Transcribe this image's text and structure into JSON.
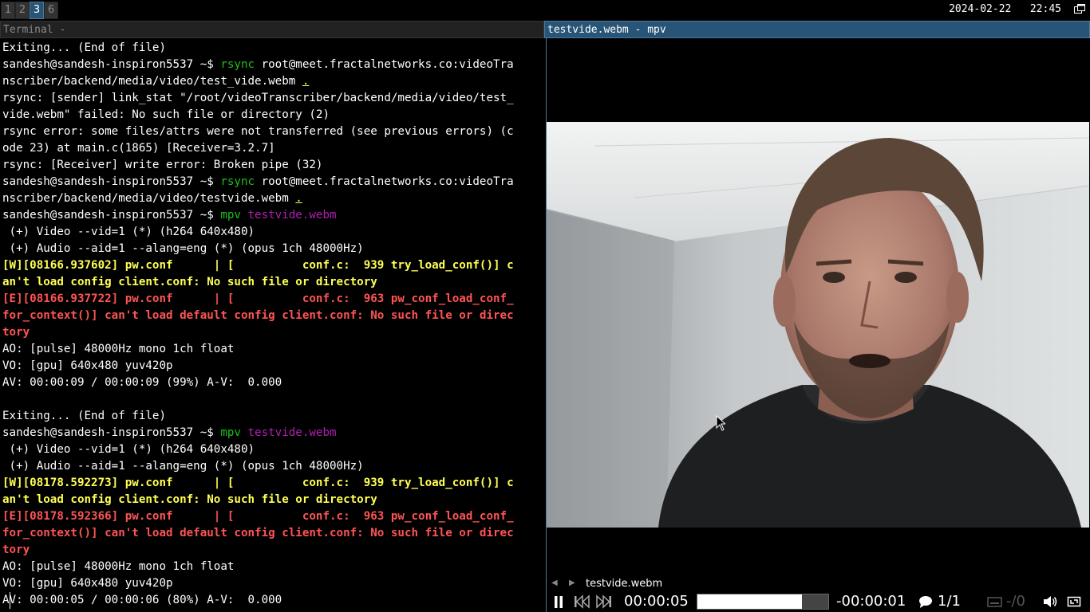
{
  "topbar": {
    "workspaces": [
      {
        "label": "1",
        "active": false
      },
      {
        "label": "2",
        "active": false
      },
      {
        "label": "3",
        "active": true
      },
      {
        "label": "6",
        "active": false
      }
    ],
    "date": "2024-02-22",
    "time": "22:45"
  },
  "terminal": {
    "title": "Terminal -",
    "lines": [
      {
        "type": "plain",
        "text": "Exiting... (End of file)"
      },
      {
        "type": "cmd",
        "prompt": "sandesh@sandesh-inspiron5537 ~$ ",
        "cmd": "rsync",
        "rest": " root@meet.fractalnetworks.co:videoTra"
      },
      {
        "type": "cont",
        "text": "nscriber/backend/media/video/test_vide.webm ",
        "und": "."
      },
      {
        "type": "plain",
        "text": "rsync: [sender] link_stat \"/root/videoTranscriber/backend/media/video/test_"
      },
      {
        "type": "plain",
        "text": "vide.webm\" failed: No such file or directory (2)"
      },
      {
        "type": "plain",
        "text": "rsync error: some files/attrs were not transferred (see previous errors) (c"
      },
      {
        "type": "plain",
        "text": "ode 23) at main.c(1865) [Receiver=3.2.7]"
      },
      {
        "type": "plain",
        "text": "rsync: [Receiver] write error: Broken pipe (32)"
      },
      {
        "type": "cmd",
        "prompt": "sandesh@sandesh-inspiron5537 ~$ ",
        "cmd": "rsync",
        "rest": " root@meet.fractalnetworks.co:videoTra"
      },
      {
        "type": "cont",
        "text": "nscriber/backend/media/video/testvide.webm ",
        "und": "."
      },
      {
        "type": "mpv",
        "prompt": "sandesh@sandesh-inspiron5537 ~$ ",
        "cmd": "mpv",
        "arg": " testvide.webm"
      },
      {
        "type": "plain",
        "text": " (+) Video --vid=1 (*) (h264 640x480)"
      },
      {
        "type": "plain",
        "text": " (+) Audio --aid=1 --alang=eng (*) (opus 1ch 48000Hz)"
      },
      {
        "type": "warn",
        "text": "[W][08166.937602] pw.conf      | [          conf.c:  939 try_load_conf()] c"
      },
      {
        "type": "warn",
        "text": "an't load config client.conf: No such file or directory"
      },
      {
        "type": "err",
        "text": "[E][08166.937722] pw.conf      | [          conf.c:  963 pw_conf_load_conf_"
      },
      {
        "type": "err",
        "text": "for_context()] can't load default config client.conf: No such file or direc"
      },
      {
        "type": "err",
        "text": "tory"
      },
      {
        "type": "plain",
        "text": "AO: [pulse] 48000Hz mono 1ch float"
      },
      {
        "type": "plain",
        "text": "VO: [gpu] 640x480 yuv420p"
      },
      {
        "type": "plain",
        "text": "AV: 00:00:09 / 00:00:09 (99%) A-V:  0.000"
      },
      {
        "type": "plain",
        "text": ""
      },
      {
        "type": "plain",
        "text": "Exiting... (End of file)"
      },
      {
        "type": "mpv",
        "prompt": "sandesh@sandesh-inspiron5537 ~$ ",
        "cmd": "mpv",
        "arg": " testvide.webm"
      },
      {
        "type": "plain",
        "text": " (+) Video --vid=1 (*) (h264 640x480)"
      },
      {
        "type": "plain",
        "text": " (+) Audio --aid=1 --alang=eng (*) (opus 1ch 48000Hz)"
      },
      {
        "type": "warn",
        "text": "[W][08178.592273] pw.conf      | [          conf.c:  939 try_load_conf()] c"
      },
      {
        "type": "warn",
        "text": "an't load config client.conf: No such file or directory"
      },
      {
        "type": "err",
        "text": "[E][08178.592366] pw.conf      | [          conf.c:  963 pw_conf_load_conf_"
      },
      {
        "type": "err",
        "text": "for_context()] can't load default config client.conf: No such file or direc"
      },
      {
        "type": "err",
        "text": "tory"
      },
      {
        "type": "plain",
        "text": "AO: [pulse] 48000Hz mono 1ch float"
      },
      {
        "type": "plain",
        "text": "VO: [gpu] 640x480 yuv420p"
      },
      {
        "type": "cursorline",
        "cursor": "A",
        "text": "V: 00:00:05 / 00:00:06 (80%) A-V:  0.000"
      }
    ]
  },
  "mpv": {
    "title": "testvide.webm - mpv",
    "playlist_name": "testvide.webm",
    "time_current": "00:00:05",
    "time_remaining": "-00:00:01",
    "seek_progress": 0.8,
    "chapters": "1/1",
    "subtitles": "-/0"
  },
  "colors": {
    "active_border": "#4c7899",
    "active_title_bg": "#285577",
    "prompt_green": "#1fbf1f",
    "arg_magenta": "#b01fb0",
    "warning_yellow": "#ffff54",
    "error_red": "#ff5454"
  }
}
